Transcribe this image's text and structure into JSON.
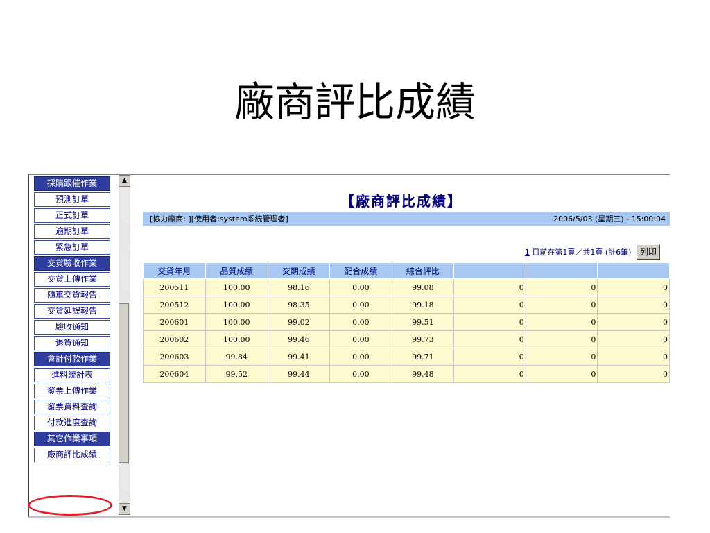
{
  "slide_title": "廠商評比成績",
  "sidebar": {
    "items": [
      {
        "label": "採購跟催作業",
        "type": "cat"
      },
      {
        "label": "預測訂單",
        "type": "item"
      },
      {
        "label": "正式訂單",
        "type": "item"
      },
      {
        "label": "逾期訂單",
        "type": "item"
      },
      {
        "label": "緊急訂單",
        "type": "item"
      },
      {
        "label": "交貨驗收作業",
        "type": "cat"
      },
      {
        "label": "交貨上傳作業",
        "type": "item"
      },
      {
        "label": "隨車交貨報告",
        "type": "item"
      },
      {
        "label": "交貨延誤報告",
        "type": "item"
      },
      {
        "label": "驗收通知",
        "type": "item"
      },
      {
        "label": "退貨通知",
        "type": "item"
      },
      {
        "label": "會計付款作業",
        "type": "cat"
      },
      {
        "label": "進料統計表",
        "type": "item"
      },
      {
        "label": "發票上傳作業",
        "type": "item"
      },
      {
        "label": "發票資料查詢",
        "type": "item"
      },
      {
        "label": "付款進度查詢",
        "type": "item"
      },
      {
        "label": "其它作業事項",
        "type": "cat"
      },
      {
        "label": "廠商評比成績",
        "type": "item"
      }
    ]
  },
  "scrollbar": {
    "up": "▲",
    "down": "▼"
  },
  "content": {
    "heading": "【廠商評比成績】",
    "info_left": "[協力廠商:         ][使用者:system系統管理者]",
    "info_right": "2006/5/03 (星期三) - 15:00:04",
    "pager_page": "1",
    "pager_text": " 目前在第1頁／共1頁 (計6筆) ",
    "print_label": "列印"
  },
  "table": {
    "headers": [
      "交貨年月",
      "品質成績",
      "交期成績",
      "配合成績",
      "綜合評比",
      "",
      "",
      ""
    ],
    "rows": [
      [
        "200511",
        "100.00",
        "98.16",
        "0.00",
        "99.08",
        "0",
        "0",
        "0"
      ],
      [
        "200512",
        "100.00",
        "98.35",
        "0.00",
        "99.18",
        "0",
        "0",
        "0"
      ],
      [
        "200601",
        "100.00",
        "99.02",
        "0.00",
        "99.51",
        "0",
        "0",
        "0"
      ],
      [
        "200602",
        "100.00",
        "99.46",
        "0.00",
        "99.73",
        "0",
        "0",
        "0"
      ],
      [
        "200603",
        "99.84",
        "99.41",
        "0.00",
        "99.71",
        "0",
        "0",
        "0"
      ],
      [
        "200604",
        "99.52",
        "99.44",
        "0.00",
        "99.48",
        "0",
        "0",
        "0"
      ]
    ]
  },
  "colors": {
    "accent": "#2f3e9e",
    "header_bg": "#a7c9f1",
    "cell_bg": "#fffbd0",
    "highlight": "#e0202a"
  }
}
